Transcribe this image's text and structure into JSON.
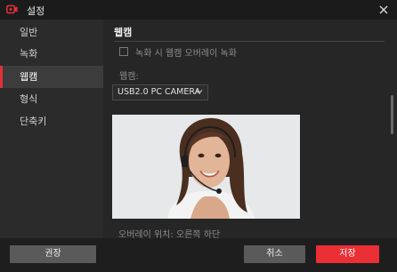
{
  "window": {
    "title": "설정"
  },
  "sidebar": {
    "items": [
      {
        "label": "일반"
      },
      {
        "label": "녹화"
      },
      {
        "label": "웹캠"
      },
      {
        "label": "형식"
      },
      {
        "label": "단축키"
      }
    ],
    "active_index": 2
  },
  "main": {
    "section_title": "웹캠",
    "overlay_checkbox": {
      "label": "녹화 시 웹캠 오버레이 녹화",
      "checked": false
    },
    "webcam_label": "웹캠:",
    "webcam_select": {
      "value": "USB2.0 PC CAMERA"
    },
    "overlay_position": "오버레이 위치: 오른쪽 하단"
  },
  "footer": {
    "recommended_label": "권장",
    "cancel_label": "취소",
    "save_label": "저장"
  },
  "colors": {
    "accent": "#ea2f35",
    "background": "#262626",
    "sidebar": "#2b2b2b"
  },
  "icons": {
    "app": "camera-record-icon",
    "close": "close-icon",
    "dropdown": "chevron-down-icon"
  }
}
